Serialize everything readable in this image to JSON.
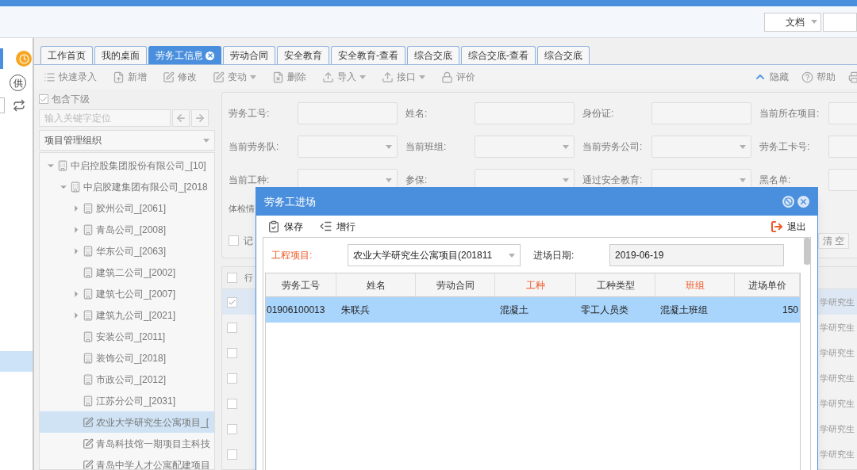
{
  "header": {
    "doc_select": {
      "value": "文档"
    }
  },
  "rail": {
    "badge": "供"
  },
  "tabs": [
    {
      "label": "工作首页",
      "selected": false
    },
    {
      "label": "我的桌面",
      "selected": false
    },
    {
      "label": "劳务工信息",
      "selected": true
    },
    {
      "label": "劳动合同",
      "selected": false
    },
    {
      "label": "安全教育",
      "selected": false
    },
    {
      "label": "安全教育-查看",
      "selected": false
    },
    {
      "label": "综合交底",
      "selected": false
    },
    {
      "label": "综合交底-查看",
      "selected": false
    },
    {
      "label": "综合交底",
      "selected": false
    }
  ],
  "toolbar": {
    "left": [
      {
        "label": "快速录入",
        "kind": "list",
        "has_menu": false
      },
      {
        "label": "新增",
        "kind": "add",
        "has_menu": false
      },
      {
        "label": "修改",
        "kind": "edit",
        "has_menu": false
      },
      {
        "label": "变动",
        "kind": "edit",
        "has_menu": true
      },
      {
        "label": "删除",
        "kind": "delete",
        "has_menu": false
      },
      {
        "label": "导入",
        "kind": "import",
        "has_menu": true
      },
      {
        "label": "接口",
        "kind": "import",
        "has_menu": true
      },
      {
        "label": "评价",
        "kind": "lock",
        "has_menu": false
      }
    ],
    "right": [
      {
        "label": "隐藏",
        "kind": "hide"
      },
      {
        "label": "帮助",
        "kind": "help"
      }
    ]
  },
  "org_panel": {
    "include_sub": {
      "label": "包含下级",
      "checked": true
    },
    "search": {
      "placeholder": "输入关键字定位"
    },
    "org_select": {
      "value": "项目管理组织"
    },
    "tree": [
      {
        "label": "中启控股集团股份有限公司_[10]",
        "kind": "org",
        "expanded": true,
        "selected": false,
        "children": [
          {
            "label": "中启胶建集团有限公司_[2018",
            "kind": "org",
            "expanded": true,
            "selected": false,
            "children": [
              {
                "label": "胶州公司_[2061]",
                "kind": "org",
                "expanded": false,
                "selected": false
              },
              {
                "label": "青岛公司_[2008]",
                "kind": "org",
                "expanded": false,
                "selected": false
              },
              {
                "label": "华东公司_[2063]",
                "kind": "org",
                "expanded": false,
                "selected": false
              },
              {
                "label": "建筑二公司_[2002]",
                "kind": "org",
                "selected": false
              },
              {
                "label": "建筑七公司_[2007]",
                "kind": "org",
                "expanded": false,
                "selected": false
              },
              {
                "label": "建筑九公司_[2021]",
                "kind": "org",
                "expanded": false,
                "selected": false
              },
              {
                "label": "安装公司_[2011]",
                "kind": "org",
                "selected": false
              },
              {
                "label": "装饰公司_[2018]",
                "kind": "org",
                "selected": false
              },
              {
                "label": "市政公司_[2012]",
                "kind": "org",
                "selected": false
              },
              {
                "label": "江苏分公司_[2031]",
                "kind": "org",
                "selected": false
              },
              {
                "label": "农业大学研究生公寓项目_[",
                "kind": "project",
                "selected": true
              },
              {
                "label": "青岛科技馆一期项目主科技",
                "kind": "project",
                "selected": false
              },
              {
                "label": "青岛中学人才公寓配建项目",
                "kind": "project",
                "selected": false
              }
            ]
          }
        ]
      }
    ]
  },
  "filter_form": {
    "fields": [
      {
        "label": "劳务工号:",
        "kind": "text"
      },
      {
        "label": "姓名:",
        "kind": "text"
      },
      {
        "label": "身份证:",
        "kind": "text"
      },
      {
        "label": "当前所在项目:",
        "kind": "text"
      },
      {
        "label": "当前劳务队:",
        "kind": "select"
      },
      {
        "label": "当前班组:",
        "kind": "select"
      },
      {
        "label": "当前劳务公司:",
        "kind": "select"
      },
      {
        "label": "劳务工卡号:",
        "kind": "text"
      },
      {
        "label": "当前工种:",
        "kind": "select"
      },
      {
        "label": "参保:",
        "kind": "select"
      },
      {
        "label": "通过安全教育:",
        "kind": "select"
      },
      {
        "label": "黑名单:",
        "kind": "text"
      }
    ],
    "partial_label": "体检情",
    "checkbox": {
      "label": "记",
      "checked": false
    },
    "clear_button": "清 空"
  },
  "worker_grid": {
    "select_all": {
      "checked": false
    },
    "header": "行",
    "rows": [
      {
        "selected": true,
        "column_2": "学研究生"
      },
      {
        "selected": false,
        "column_2": "学研究生"
      },
      {
        "selected": false,
        "column_2": "学研究生"
      },
      {
        "selected": false,
        "column_2": "学研究生"
      },
      {
        "selected": false,
        "column_2": "学研究生"
      },
      {
        "selected": false,
        "column_2": "学研究生"
      },
      {
        "selected": false,
        "column_2": "学研究生"
      }
    ]
  },
  "dialog": {
    "title": "劳务工进场",
    "toolbar": [
      {
        "label": "保存",
        "kind": "save"
      },
      {
        "label": "增行",
        "kind": "add_row"
      }
    ],
    "exit": "退出",
    "project": {
      "label": "工程项目:",
      "required": true,
      "value": "农业大学研究生公寓项目(201811"
    },
    "date": {
      "label": "进场日期:",
      "value": "2019-06-19"
    },
    "table": {
      "columns": [
        {
          "label": "劳务工号",
          "required": false
        },
        {
          "label": "姓名",
          "required": false
        },
        {
          "label": "劳动合同",
          "required": false
        },
        {
          "label": "工种",
          "required": true
        },
        {
          "label": "工种类型",
          "required": false
        },
        {
          "label": "班组",
          "required": true
        },
        {
          "label": "进场单价",
          "required": false
        }
      ],
      "rows": [
        {
          "selected": true,
          "cells": [
            "01906100013",
            "朱联兵",
            "",
            "混凝土",
            "零工人员类",
            "混凝土班组",
            "150"
          ]
        }
      ]
    }
  }
}
